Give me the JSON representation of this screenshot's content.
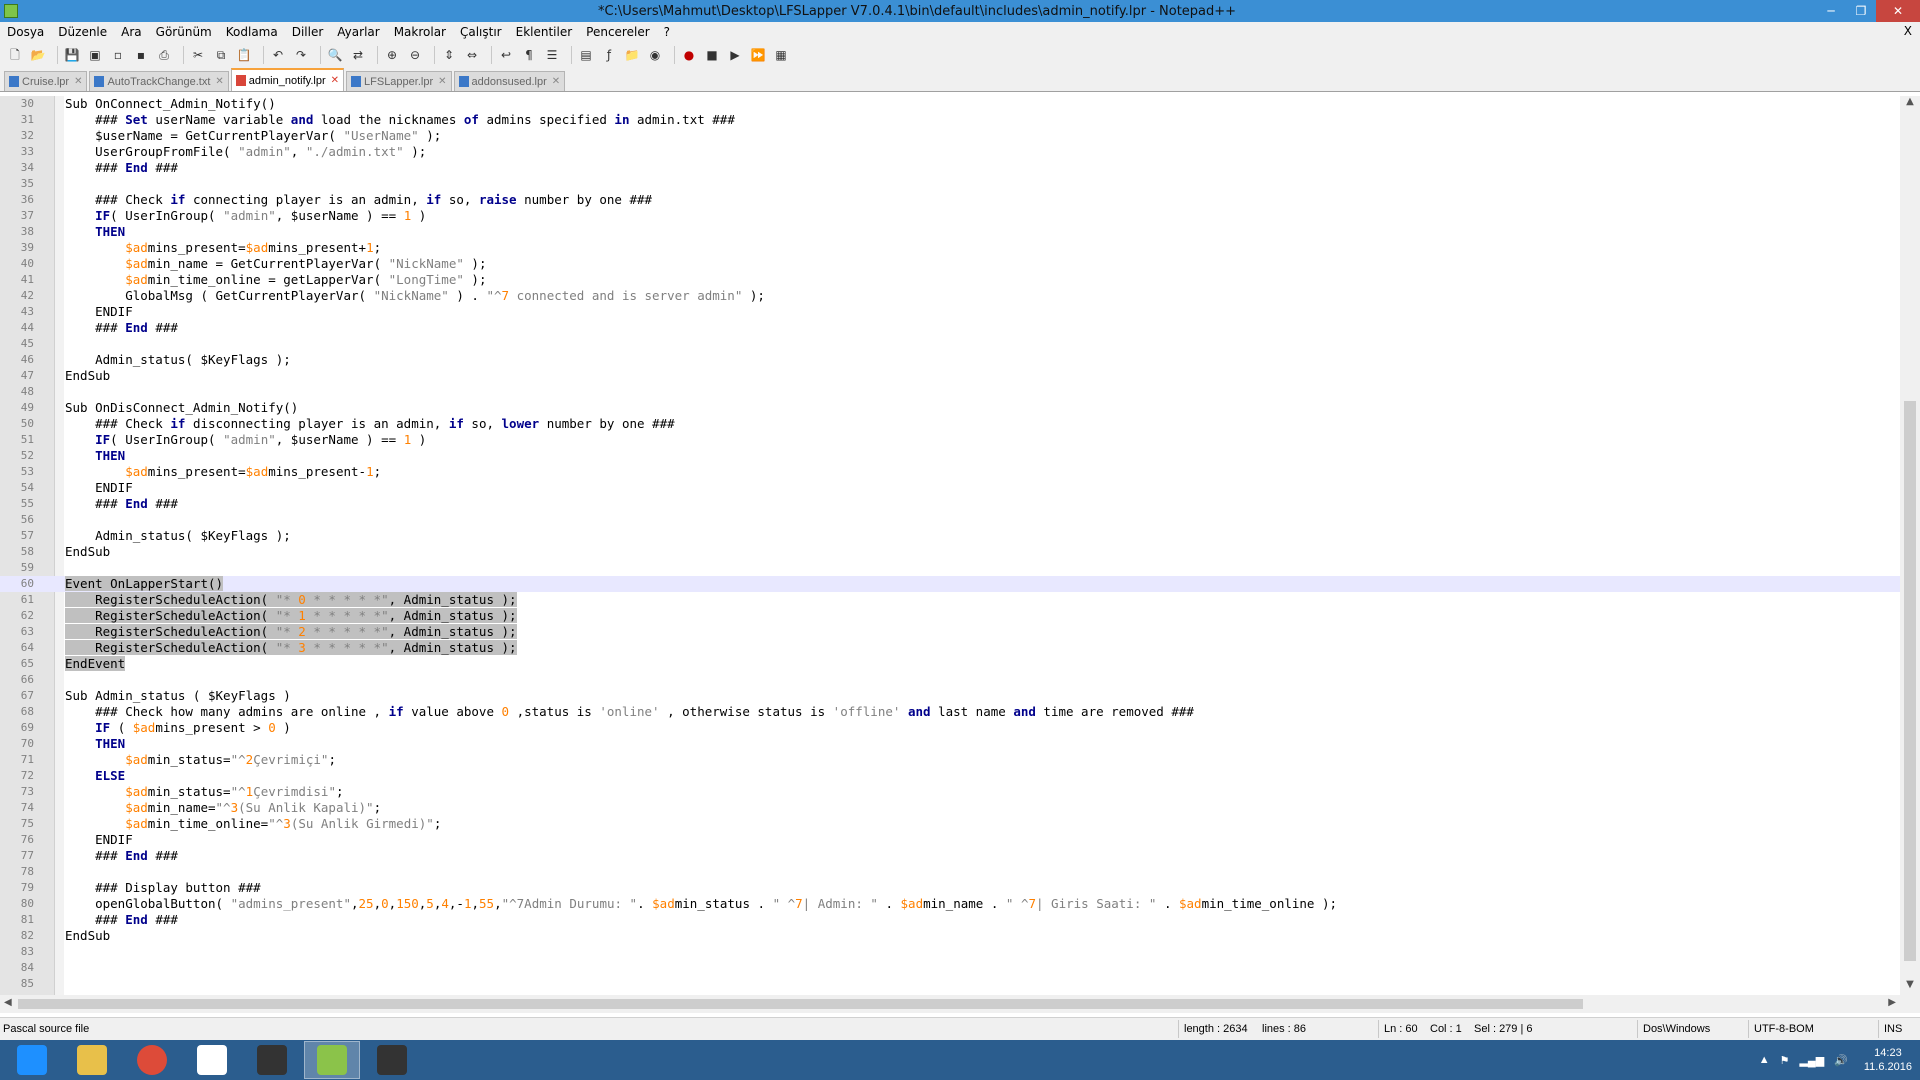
{
  "window": {
    "title": "*C:\\Users\\Mahmut\\Desktop\\LFSLapper V7.0.4.1\\bin\\default\\includes\\admin_notify.lpr - Notepad++",
    "minimize": "─",
    "restore": "❐",
    "close": "✕"
  },
  "menu": {
    "items": [
      "Dosya",
      "Düzenle",
      "Ara",
      "Görünüm",
      "Kodlama",
      "Diller",
      "Ayarlar",
      "Makrolar",
      "Çalıştır",
      "Eklentiler",
      "Pencereler",
      "?"
    ],
    "close_doc": "X"
  },
  "toolbar": {
    "icons": [
      "new-file-icon",
      "open-file-icon",
      "save-icon",
      "save-all-icon",
      "close-icon",
      "close-all-icon",
      "print-icon",
      "cut-icon",
      "copy-icon",
      "paste-icon",
      "undo-icon",
      "redo-icon",
      "find-icon",
      "replace-icon",
      "zoom-in-icon",
      "zoom-out-icon",
      "sync-v-icon",
      "sync-h-icon",
      "wrap-icon",
      "all-chars-icon",
      "indent-guide-icon",
      "doc-map-icon",
      "function-list-icon",
      "folder-icon",
      "monitor-icon",
      "record-macro-icon",
      "stop-macro-icon",
      "play-macro-icon",
      "run-multi-macro-icon",
      "save-macro-icon"
    ]
  },
  "tabs": [
    {
      "label": "Cruise.lpr",
      "active": false
    },
    {
      "label": "AutoTrackChange.txt",
      "active": false
    },
    {
      "label": "admin_notify.lpr",
      "active": true
    },
    {
      "label": "LFSLapper.lpr",
      "active": false
    },
    {
      "label": "addonsused.lpr",
      "active": false
    }
  ],
  "editor": {
    "current_line": 60,
    "lines": [
      {
        "n": "30",
        "t": "Sub OnConnect_Admin_Notify()"
      },
      {
        "n": "31",
        "t": "    ### Set userName variable and load the nicknames of admins specified in admin.txt ###"
      },
      {
        "n": "32",
        "t": "    $userName = GetCurrentPlayerVar( \"UserName\" );"
      },
      {
        "n": "33",
        "t": "    UserGroupFromFile( \"admin\", \"./admin.txt\" );"
      },
      {
        "n": "34",
        "t": "    ### End ###"
      },
      {
        "n": "35",
        "t": ""
      },
      {
        "n": "36",
        "t": "    ### Check if connecting player is an admin, if so, raise number by one ###"
      },
      {
        "n": "37",
        "t": "    IF( UserInGroup( \"admin\", $userName ) == 1 )"
      },
      {
        "n": "38",
        "t": "    THEN"
      },
      {
        "n": "39",
        "t": "        $admins_present=$admins_present+1;"
      },
      {
        "n": "40",
        "t": "        $admin_name = GetCurrentPlayerVar( \"NickName\" );"
      },
      {
        "n": "41",
        "t": "        $admin_time_online = getLapperVar( \"LongTime\" );"
      },
      {
        "n": "42",
        "t": "        GlobalMsg ( GetCurrentPlayerVar( \"NickName\" ) . \"^7 connected and is server admin\" );"
      },
      {
        "n": "43",
        "t": "    ENDIF"
      },
      {
        "n": "44",
        "t": "    ### End ###"
      },
      {
        "n": "45",
        "t": ""
      },
      {
        "n": "46",
        "t": "    Admin_status( $KeyFlags );"
      },
      {
        "n": "47",
        "t": "EndSub"
      },
      {
        "n": "48",
        "t": ""
      },
      {
        "n": "49",
        "t": "Sub OnDisConnect_Admin_Notify()"
      },
      {
        "n": "50",
        "t": "    ### Check if disconnecting player is an admin, if so, lower number by one ###"
      },
      {
        "n": "51",
        "t": "    IF( UserInGroup( \"admin\", $userName ) == 1 )"
      },
      {
        "n": "52",
        "t": "    THEN"
      },
      {
        "n": "53",
        "t": "        $admins_present=$admins_present-1;"
      },
      {
        "n": "54",
        "t": "    ENDIF"
      },
      {
        "n": "55",
        "t": "    ### End ###"
      },
      {
        "n": "56",
        "t": ""
      },
      {
        "n": "57",
        "t": "    Admin_status( $KeyFlags );"
      },
      {
        "n": "58",
        "t": "EndSub"
      },
      {
        "n": "59",
        "t": ""
      },
      {
        "n": "60",
        "t": "Event OnLapperStart()"
      },
      {
        "n": "61",
        "t": "    RegisterScheduleAction( \"* 0 * * * * *\", Admin_status );"
      },
      {
        "n": "62",
        "t": "    RegisterScheduleAction( \"* 1 * * * * *\", Admin_status );"
      },
      {
        "n": "63",
        "t": "    RegisterScheduleAction( \"* 2 * * * * *\", Admin_status );"
      },
      {
        "n": "64",
        "t": "    RegisterScheduleAction( \"* 3 * * * * *\", Admin_status );"
      },
      {
        "n": "65",
        "t": "EndEvent"
      },
      {
        "n": "66",
        "t": ""
      },
      {
        "n": "67",
        "t": "Sub Admin_status ( $KeyFlags )"
      },
      {
        "n": "68",
        "t": "    ### Check how many admins are online , if value above 0 ,status is 'online' , otherwise status is 'offline' and last name and time are removed ###"
      },
      {
        "n": "69",
        "t": "    IF ( $admins_present > 0 )"
      },
      {
        "n": "70",
        "t": "    THEN"
      },
      {
        "n": "71",
        "t": "        $admin_status=\"^2Çevrimiçi\";"
      },
      {
        "n": "72",
        "t": "    ELSE"
      },
      {
        "n": "73",
        "t": "        $admin_status=\"^1Çevrimdisi\";"
      },
      {
        "n": "74",
        "t": "        $admin_name=\"^3(Su Anlik Kapali)\";"
      },
      {
        "n": "75",
        "t": "        $admin_time_online=\"^3(Su Anlik Girmedi)\";"
      },
      {
        "n": "76",
        "t": "    ENDIF"
      },
      {
        "n": "77",
        "t": "    ### End ###"
      },
      {
        "n": "78",
        "t": ""
      },
      {
        "n": "79",
        "t": "    ### Display button ###"
      },
      {
        "n": "80",
        "t": "    openGlobalButton( \"admins_present\",25,0,150,5,4,-1,55,\"^7Admin Durumu: \". $admin_status . \" ^7| Admin: \" . $admin_name . \" ^7| Giris Saati: \" . $admin_time_online );"
      },
      {
        "n": "81",
        "t": "    ### End ###"
      },
      {
        "n": "82",
        "t": "EndSub"
      },
      {
        "n": "83",
        "t": ""
      },
      {
        "n": "84",
        "t": ""
      },
      {
        "n": "85",
        "t": ""
      }
    ]
  },
  "status": {
    "file_type": "Pascal source file",
    "length": "length : 2634",
    "lines": "lines : 86",
    "ln": "Ln : 60",
    "col": "Col : 1",
    "sel": "Sel : 279 | 6",
    "eol": "Dos\\Windows",
    "encoding": "UTF-8-BOM",
    "mode": "INS"
  },
  "taskbar": {
    "apps": [
      "internet-explorer-icon",
      "file-explorer-icon",
      "chrome-icon",
      "lfs-l-icon",
      "lfs-lapper-icon",
      "notepad-plus-plus-icon",
      "lfs-lapper-2-icon"
    ],
    "time": "14:23",
    "date": "11.6.2016"
  },
  "colors": {
    "titlebar": "#3b8fd4",
    "keyword": "#00008b",
    "string": "#808080",
    "number": "#ff8000",
    "selection": "#c0c0c0",
    "current_line": "#e8e8ff",
    "taskbar": "#2b5d8e"
  }
}
